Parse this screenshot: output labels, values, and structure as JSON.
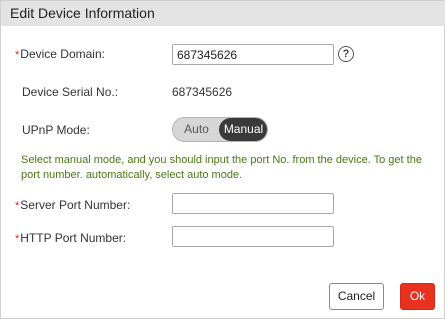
{
  "dialog": {
    "title": "Edit Device Information"
  },
  "fields": {
    "required_marker": "*",
    "device_domain": {
      "label": "Device Domain:",
      "value": "687345626"
    },
    "serial": {
      "label": "Device Serial No.:",
      "value": "687345626"
    },
    "upnp": {
      "label": "UPnP Mode:",
      "options": [
        "Auto",
        "Manual"
      ],
      "selected": "Manual"
    },
    "hint": "Select manual mode, and you should input the port No. from the device. To get the port number. automatically, select auto mode.",
    "server_port": {
      "label": "Server Port Number:",
      "value": ""
    },
    "http_port": {
      "label": "HTTP Port Number:",
      "value": ""
    },
    "help_glyph": "?"
  },
  "buttons": {
    "cancel": "Cancel",
    "ok": "Ok"
  },
  "colors": {
    "required": "#e0281f",
    "hint_text": "#4a7a14",
    "ok_button": "#e8311f",
    "toggle_selected": "#3a3a3a"
  },
  "icons": {
    "help": "help-circle-icon"
  }
}
